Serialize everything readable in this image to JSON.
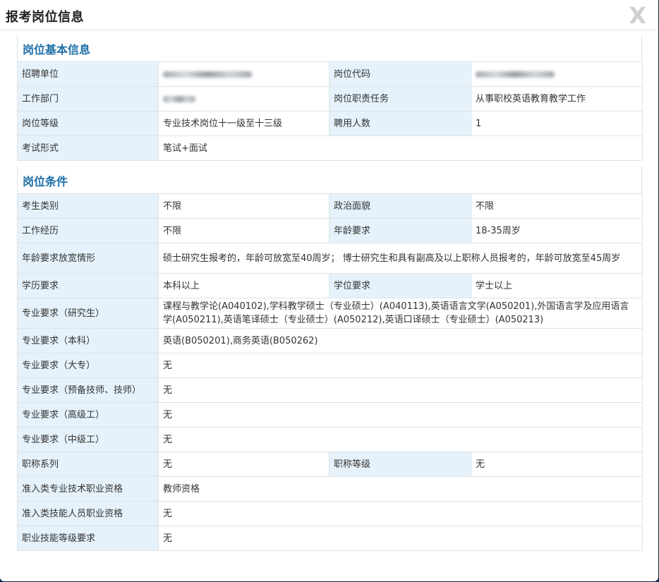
{
  "dialog": {
    "title": "报考岗位信息",
    "close_label": "X"
  },
  "basic": {
    "heading": "岗位基本信息",
    "employer_label": "招聘单位",
    "employer_value": "",
    "code_label": "岗位代码",
    "code_value": "",
    "dept_label": "工作部门",
    "dept_value": "",
    "duty_label": "岗位职责任务",
    "duty_value": "从事职校英语教育教学工作",
    "level_label": "岗位等级",
    "level_value": "专业技术岗位十一级至十三级",
    "hires_label": "聘用人数",
    "hires_value": "1",
    "exam_label": "考试形式",
    "exam_value": "笔试+面试"
  },
  "conditions": {
    "heading": "岗位条件",
    "candidate_label": "考生类别",
    "candidate_value": "不限",
    "political_label": "政治面貌",
    "political_value": "不限",
    "experience_label": "工作经历",
    "experience_value": "不限",
    "age_label": "年龄要求",
    "age_value": "18-35周岁",
    "age_relax_label": "年龄要求放宽情形",
    "age_relax_value": "硕士研究生报考的，年龄可放宽至40周岁； 博士研究生和具有副高及以上职称人员报考的，年龄可放宽至45周岁",
    "edu_label": "学历要求",
    "edu_value": "本科以上",
    "degree_label": "学位要求",
    "degree_value": "学士以上",
    "major_grad_label": "专业要求（研究生）",
    "major_grad_value": "课程与教学论(A040102),学科教学硕士（专业硕士）(A040113),英语语言文学(A050201),外国语言学及应用语言学(A050211),英语笔译硕士（专业硕士）(A050212),英语口译硕士（专业硕士）(A050213)",
    "major_bach_label": "专业要求（本科）",
    "major_bach_value": "英语(B050201),商务英语(B050262)",
    "major_college_label": "专业要求（大专）",
    "major_college_value": "无",
    "major_tech_label": "专业要求（预备技师、技师）",
    "major_tech_value": "无",
    "major_senior_label": "专业要求（高级工）",
    "major_senior_value": "无",
    "major_mid_label": "专业要求（中级工）",
    "major_mid_value": "无",
    "title_series_label": "职称系列",
    "title_series_value": "无",
    "title_grade_label": "职称等级",
    "title_grade_value": "无",
    "cert_pro_label": "准入类专业技术职业资格",
    "cert_pro_value": "教师资格",
    "cert_skill_label": "准入类技能人员职业资格",
    "cert_skill_value": "无",
    "skill_level_label": "职业技能等级要求",
    "skill_level_value": "无"
  }
}
